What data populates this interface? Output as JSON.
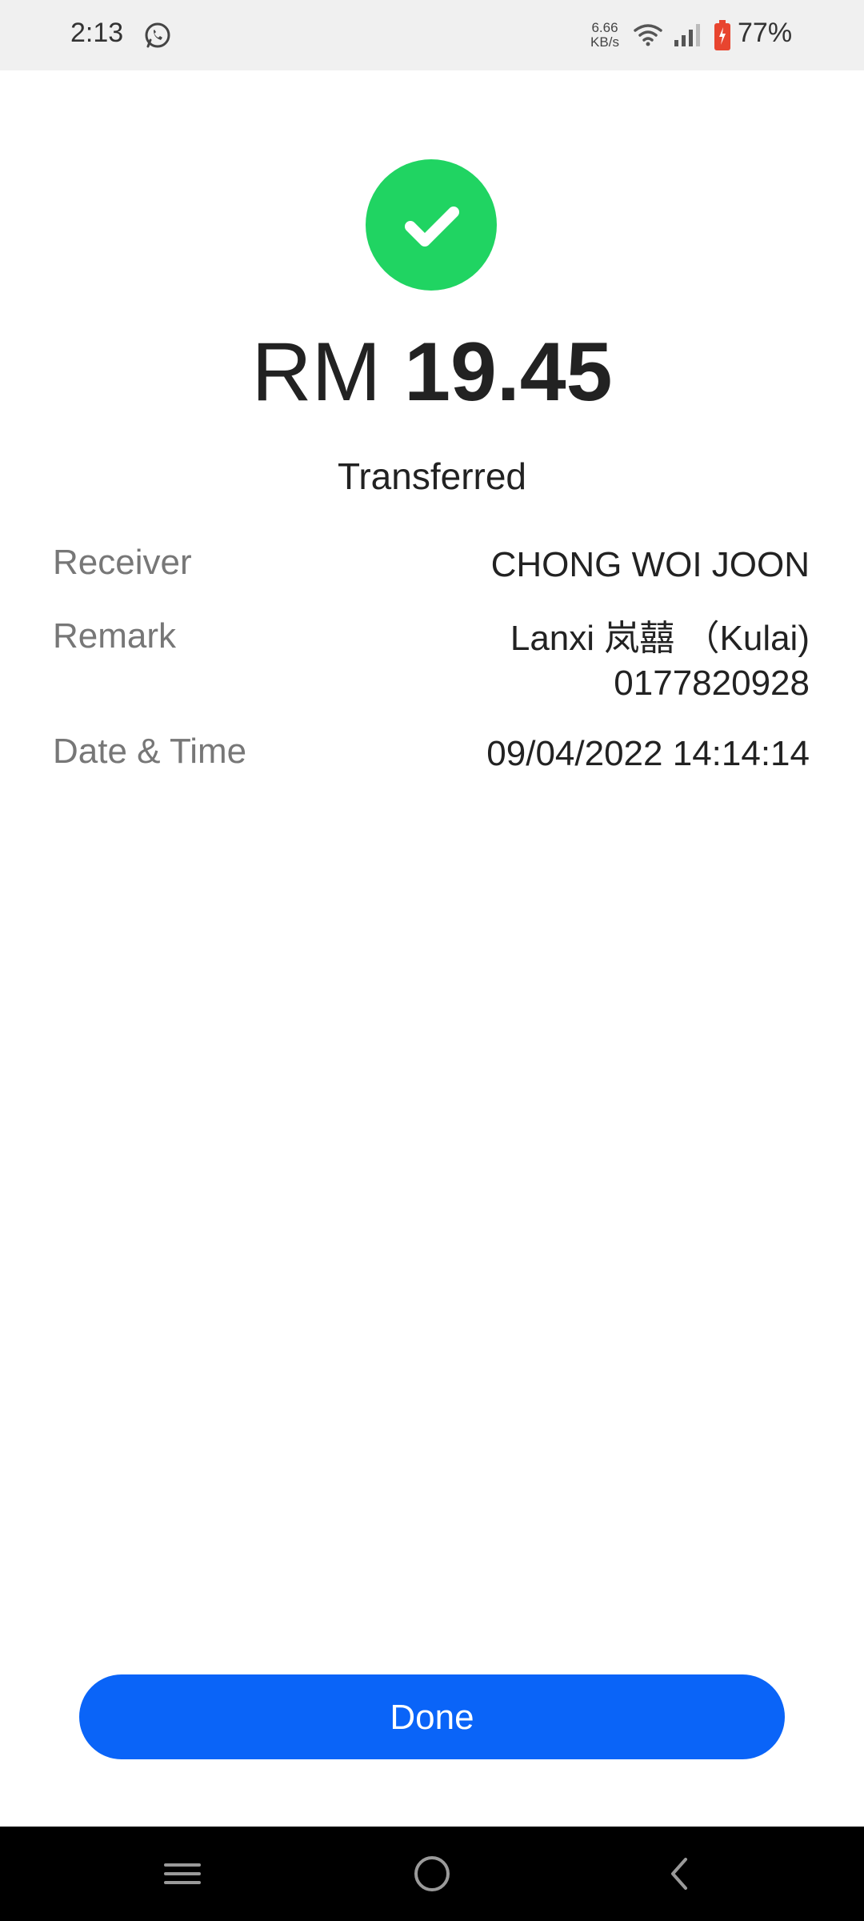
{
  "status_bar": {
    "time": "2:13",
    "net_speed_value": "6.66",
    "net_speed_unit": "KB/s",
    "battery_percent": "77%",
    "icons": [
      "whatsapp-icon",
      "wifi-icon",
      "signal-icon",
      "battery-icon"
    ],
    "battery_color": "#e8452f"
  },
  "receipt": {
    "success_color": "#20d462",
    "amount_currency": "RM",
    "amount_value": "19.45",
    "status": "Transferred",
    "details": {
      "receiver_label": "Receiver",
      "receiver_value": "CHONG WOI JOON",
      "remark_label": "Remark",
      "remark_line1": "Lanxi 岚囍 （Kulai)",
      "remark_line2": "0177820928",
      "datetime_label": "Date & Time",
      "datetime_value": "09/04/2022 14:14:14"
    }
  },
  "actions": {
    "done_label": "Done",
    "done_color": "#0a64f8"
  },
  "nav_bar": {
    "buttons": [
      "recents-icon",
      "home-icon",
      "back-icon"
    ]
  }
}
